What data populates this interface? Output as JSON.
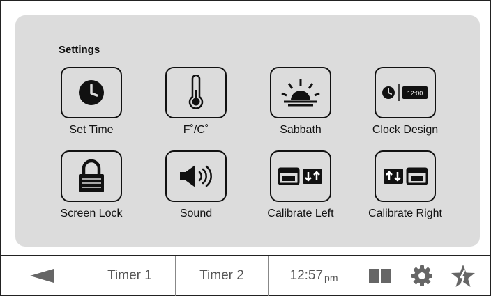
{
  "settings": {
    "title": "Settings",
    "items": [
      {
        "label": "Set Time",
        "icon": "clock-icon"
      },
      {
        "label": "F˚/C˚",
        "icon": "thermometer-icon"
      },
      {
        "label": "Sabbath",
        "icon": "sunrise-icon"
      },
      {
        "label": "Clock Design",
        "icon": "clock-design-icon",
        "clock_text": "12:00"
      },
      {
        "label": "Screen Lock",
        "icon": "lock-icon"
      },
      {
        "label": "Sound",
        "icon": "speaker-icon"
      },
      {
        "label": "Calibrate Left",
        "icon": "oven-calibrate-left-icon"
      },
      {
        "label": "Calibrate Right",
        "icon": "oven-calibrate-right-icon"
      }
    ]
  },
  "bottom_bar": {
    "back_icon": "back-arrow-icon",
    "timer1": "Timer 1",
    "timer2": "Timer 2",
    "time": "12:57",
    "ampm": "pm",
    "split_icon": "split-view-icon",
    "settings_icon": "gear-icon",
    "favorites_icon": "star-icon"
  },
  "colors": {
    "panel": "#dcdcdc",
    "icon_stroke": "#111111",
    "bar_text": "#555555"
  }
}
